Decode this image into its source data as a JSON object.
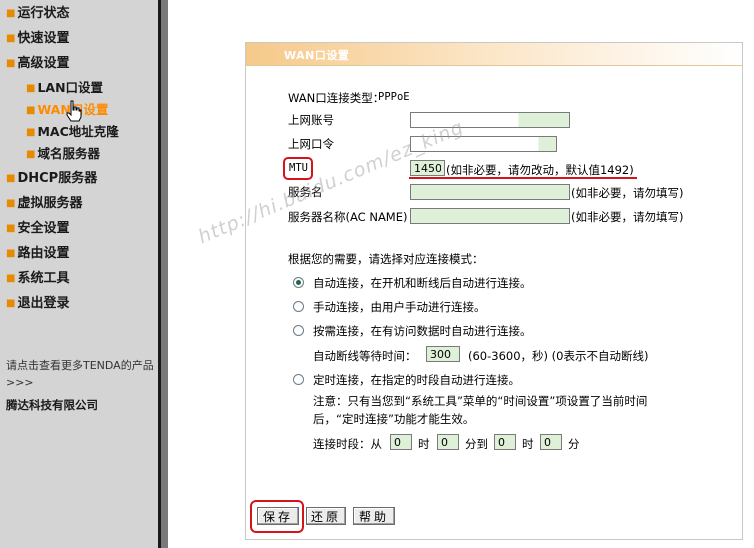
{
  "sidebar": {
    "items": [
      {
        "label": "运行状态"
      },
      {
        "label": "快速设置"
      },
      {
        "label": "高级设置"
      },
      {
        "label": "LAN口设置"
      },
      {
        "label": "WAN口设置"
      },
      {
        "label": "MAC地址克隆"
      },
      {
        "label": "域名服务器"
      },
      {
        "label": "DHCP服务器"
      },
      {
        "label": "虚拟服务器"
      },
      {
        "label": "安全设置"
      },
      {
        "label": "路由设置"
      },
      {
        "label": "系统工具"
      },
      {
        "label": "退出登录"
      }
    ],
    "promo": "请点击查看更多TENDA的产品>>>",
    "company": "腾达科技有限公司"
  },
  "panel": {
    "title": "WAN口设置",
    "conn_type_label": "WAN口连接类型：",
    "conn_type_value": "PPPoE",
    "account_label": "上网账号",
    "account_value": "",
    "password_label": "上网口令",
    "password_value": "",
    "mtu_label": "MTU",
    "mtu_value": "1450",
    "mtu_hint": "(如非必要，请勿改动，默认值1492)",
    "service_label": "服务名",
    "service_value": "",
    "service_hint": "(如非必要，请勿填写)",
    "server_label": "服务器名称(AC NAME)",
    "server_value": "",
    "server_hint": "(如非必要，请勿填写)",
    "mode_prompt": "根据您的需要，请选择对应连接模式：",
    "modes": [
      {
        "label": "自动连接，在开机和断线后自动进行连接。",
        "selected": true
      },
      {
        "label": "手动连接，由用户手动进行连接。",
        "selected": false
      },
      {
        "label": "按需连接，在有访问数据时自动进行连接。",
        "selected": false
      },
      {
        "label": "定时连接，在指定的时段自动进行连接。",
        "selected": false
      }
    ],
    "idle_label": "自动断线等待时间：",
    "idle_value": "300",
    "idle_hint": "(60-3600，秒) (0表示不自动断线)",
    "note_line1": "注意：只有当您到“系统工具”菜单的“时间设置”项设置了当前时间",
    "note_line2": "后，“定时连接”功能才能生效。",
    "period_label": "连接时段：从",
    "hour_label": "时",
    "min_to_label": "分到",
    "hour_label2": "时",
    "min_label": "分",
    "from_hour": "0",
    "from_min": "0",
    "to_hour": "0",
    "to_min": "0",
    "btn_save": "保存",
    "btn_reset": "还原",
    "btn_help": "帮助"
  },
  "watermark": "http://hi.baidu.com/ez_king",
  "colors": {
    "accent": "#ff8a00",
    "highlight": "#d4141c",
    "input_fill": "#dff0d8"
  }
}
